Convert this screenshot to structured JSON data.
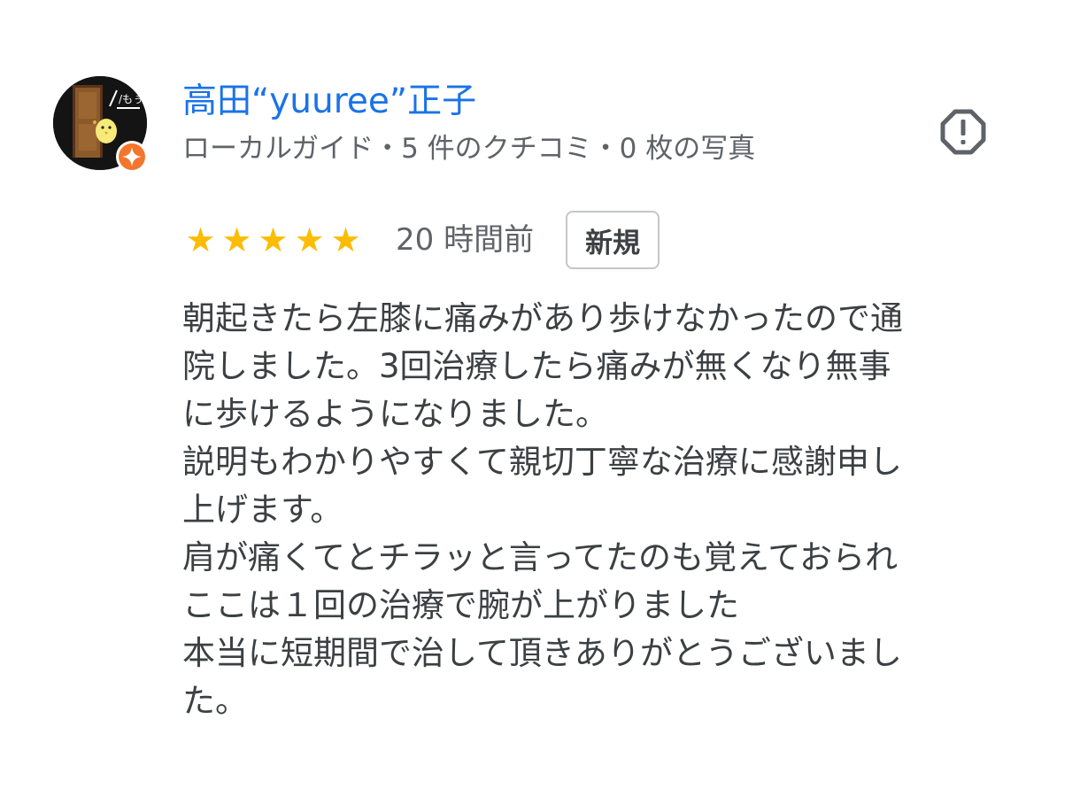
{
  "reviewer": {
    "name": "高田“yuuree”正子",
    "meta": "ローカルガイド・5 件のクチコミ・0 枚の写真",
    "avatar_text": "/もぅ…"
  },
  "review": {
    "rating": 5,
    "stars": [
      "★",
      "★",
      "★",
      "★",
      "★"
    ],
    "time": "20 時間前",
    "badge": "新規",
    "lines": [
      "朝起きたら左膝に痛みがあり歩けなかったので通",
      "院しました。3回治療したら痛みが無くなり無事",
      "に歩けるようになりました。",
      "説明もわかりやすくて親切丁寧な治療に感謝申し",
      "上げます。",
      "肩が痛くてとチラッと言ってたのも覚えておられ",
      "ここは１回の治療で腕が上がりました",
      "本当に短期間で治して頂きありがとうございまし",
      "た。"
    ]
  },
  "colors": {
    "name_link": "#1a73e8",
    "star": "#fbbc04",
    "secondary_text": "#5f6368",
    "body_text": "#3c4043",
    "guide_badge": "#f4752c"
  },
  "icons": {
    "report": "report-octagon-icon",
    "guide_badge": "local-guide-star-icon"
  }
}
